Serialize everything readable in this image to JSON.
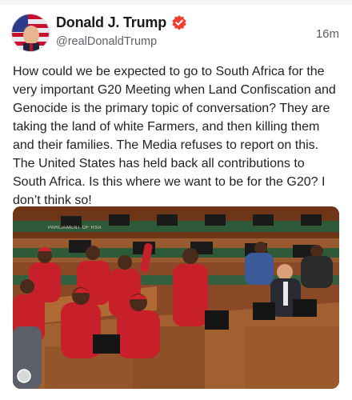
{
  "post": {
    "display_name": "Donald J. Trump",
    "handle": "@realDonaldTrump",
    "time": "16m",
    "verified": true,
    "text": "How could we be expected to go to South Africa for the very important G20 Meeting when Land Confiscation and Genocide is the primary topic of conversation? They are taking the land of white Farmers, and then killing them and their families. The Media refuses to report on this. The United States has held back all contributions to South Africa. Is this where we want to be for the G20? I don’t think so!"
  },
  "media": {
    "watermark": "PARLIAMENT OF RSA"
  },
  "colors": {
    "verified_badge": "#f03e2f",
    "text": "#222222",
    "muted": "#5f5f66"
  }
}
